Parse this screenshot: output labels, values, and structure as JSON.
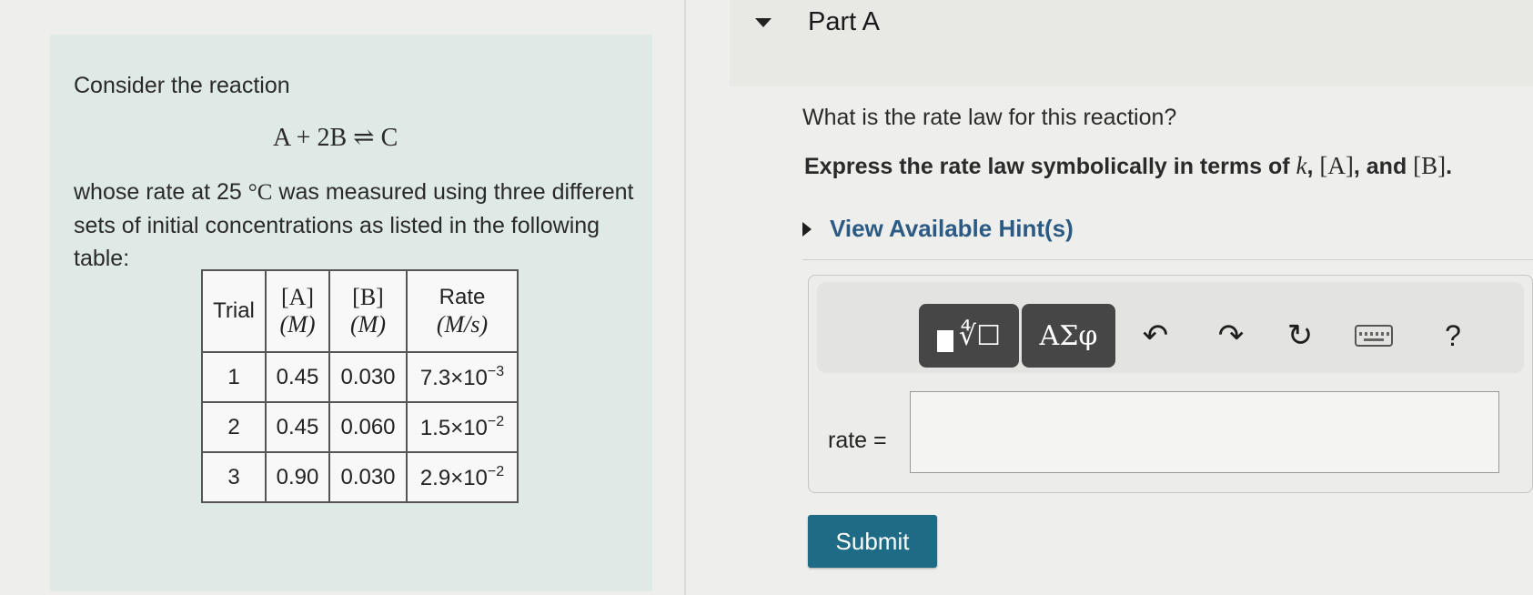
{
  "problem": {
    "intro": "Consider the reaction",
    "reaction": "A + 2B ⇌ C",
    "desc_before": "whose rate at 25",
    "temperature_unit": "°C",
    "desc_after": " was measured using three different sets of initial concentrations as listed in the following table:",
    "table": {
      "headers": {
        "trial": "Trial",
        "a_label": "[A]",
        "a_unit": "(M)",
        "b_label": "[B]",
        "b_unit": "(M)",
        "rate_label": "Rate",
        "rate_unit": "(M/s)"
      },
      "rows": [
        {
          "trial": "1",
          "a": "0.45",
          "b": "0.030",
          "rate_base": "7.3×10",
          "rate_exp": "−3"
        },
        {
          "trial": "2",
          "a": "0.45",
          "b": "0.060",
          "rate_base": "1.5×10",
          "rate_exp": "−2"
        },
        {
          "trial": "3",
          "a": "0.90",
          "b": "0.030",
          "rate_base": "2.9×10",
          "rate_exp": "−2"
        }
      ]
    }
  },
  "part": {
    "title": "Part A",
    "question": "What is the rate law for this reaction?",
    "instruction_text": "Express the rate law symbolically in terms of ",
    "instruction_k": "k",
    "instruction_a": "[A]",
    "instruction_and": ", and ",
    "instruction_b": "[B]",
    "instruction_end": ".",
    "hint_label": "View Available Hint(s)"
  },
  "toolbar": {
    "template_radical": "∜☐",
    "greek_label": "ΑΣφ",
    "undo_glyph": "↶",
    "redo_glyph": "↷",
    "reset_glyph": "↻",
    "help_label": "?",
    "icons": [
      "templates-icon",
      "greek-letters-icon",
      "undo-icon",
      "redo-icon",
      "reset-icon",
      "keyboard-icon",
      "help-icon"
    ]
  },
  "answer": {
    "rate_label": "rate =",
    "rate_value": ""
  },
  "submit_label": "Submit",
  "colors": {
    "problem_bg": "#dfe9e5",
    "hint_link": "#2b5a84",
    "submit_bg": "#1e6b86",
    "toolbar_button": "#464646"
  }
}
